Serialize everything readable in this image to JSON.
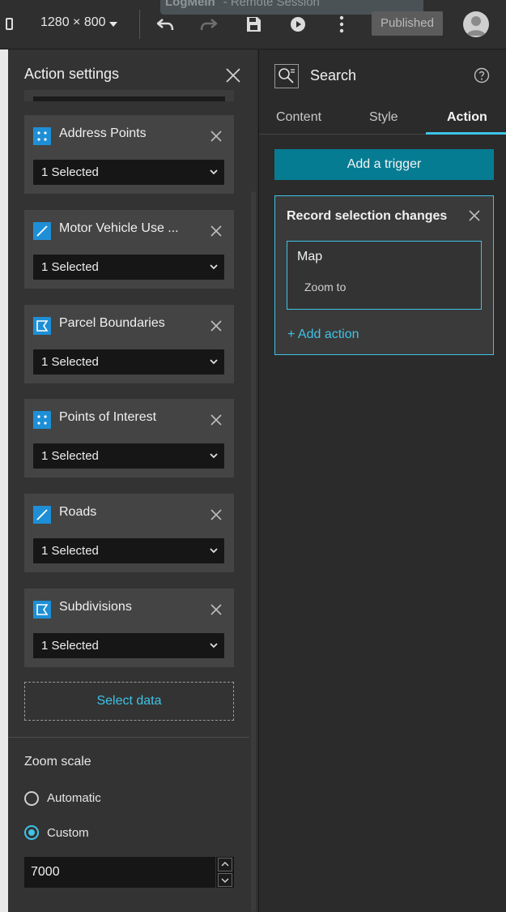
{
  "topbar": {
    "session_title": "LogMeIn",
    "session_subtitle": "- Remote Session",
    "resolution": "1280 × 800",
    "published_label": "Published",
    "icons": [
      "device-icon",
      "undo-icon",
      "redo-icon",
      "save-icon",
      "play-icon",
      "more-icon",
      "avatar-icon"
    ]
  },
  "left_panel": {
    "title": "Action settings",
    "layers": [
      {
        "name": "Address Points",
        "icon": "point-layer-icon",
        "selection": "1 Selected"
      },
      {
        "name": "Motor Vehicle Use ...",
        "icon": "line-layer-icon",
        "selection": "1 Selected"
      },
      {
        "name": "Parcel Boundaries",
        "icon": "polygon-layer-icon",
        "selection": "1 Selected"
      },
      {
        "name": "Points of Interest",
        "icon": "point-layer-icon",
        "selection": "1 Selected"
      },
      {
        "name": "Roads",
        "icon": "line-layer-icon",
        "selection": "1 Selected"
      },
      {
        "name": "Subdivisions",
        "icon": "polygon-layer-icon",
        "selection": "1 Selected"
      }
    ],
    "select_data_label": "Select data",
    "zoom_scale": {
      "title": "Zoom scale",
      "options": [
        {
          "label": "Automatic",
          "selected": false
        },
        {
          "label": "Custom",
          "selected": true
        }
      ],
      "value": "7000"
    }
  },
  "right_panel": {
    "title": "Search",
    "tabs": [
      {
        "label": "Content",
        "active": false
      },
      {
        "label": "Style",
        "active": false
      },
      {
        "label": "Action",
        "active": true
      }
    ],
    "add_trigger_label": "Add a trigger",
    "trigger": {
      "title": "Record selection changes",
      "action_target": "Map",
      "action_name": "Zoom to",
      "add_action_label": "+ Add action"
    }
  },
  "colors": {
    "accent": "#3ec3e6",
    "primary_button": "#067c93",
    "layer_icon": "#1e8fd6"
  }
}
